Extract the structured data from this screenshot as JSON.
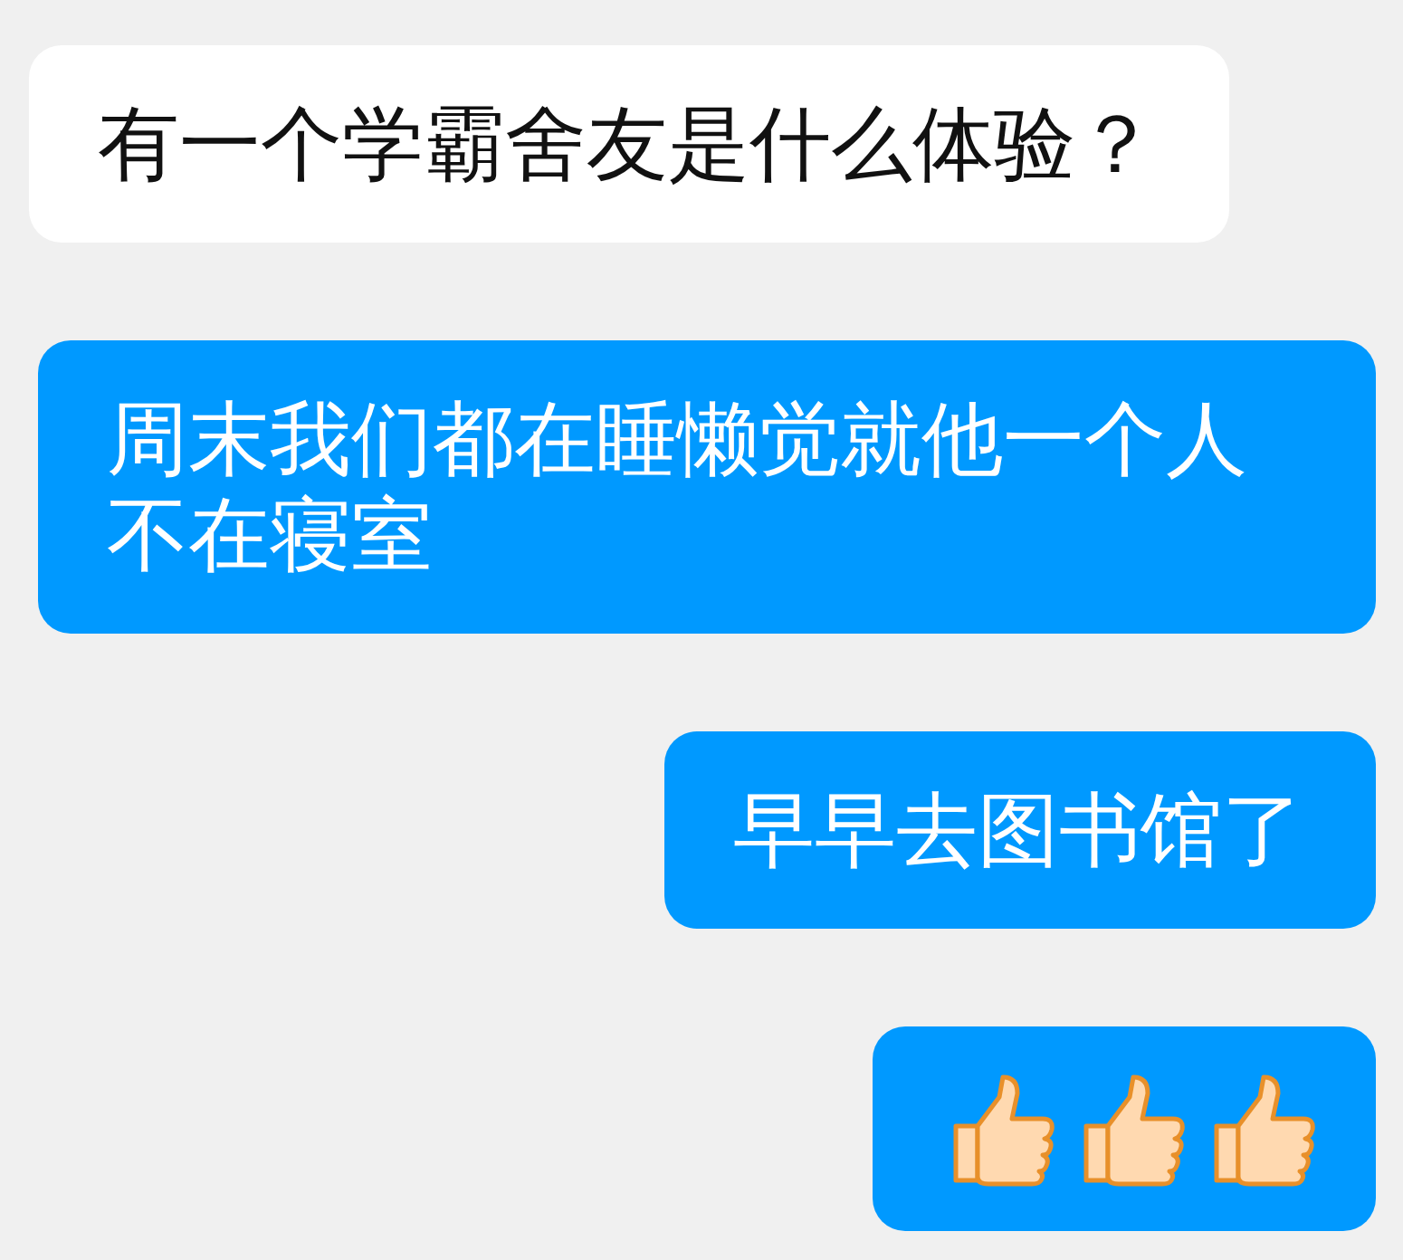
{
  "messages": [
    {
      "kind": "text",
      "sent": false,
      "text": "有一个学霸舍友是什么体验？"
    },
    {
      "kind": "text",
      "sent": true,
      "text": "周末我们都在睡懒觉就他一个人不在寝室"
    },
    {
      "kind": "text",
      "sent": true,
      "text": "早早去图书馆了"
    },
    {
      "kind": "thumbs",
      "sent": true
    }
  ]
}
